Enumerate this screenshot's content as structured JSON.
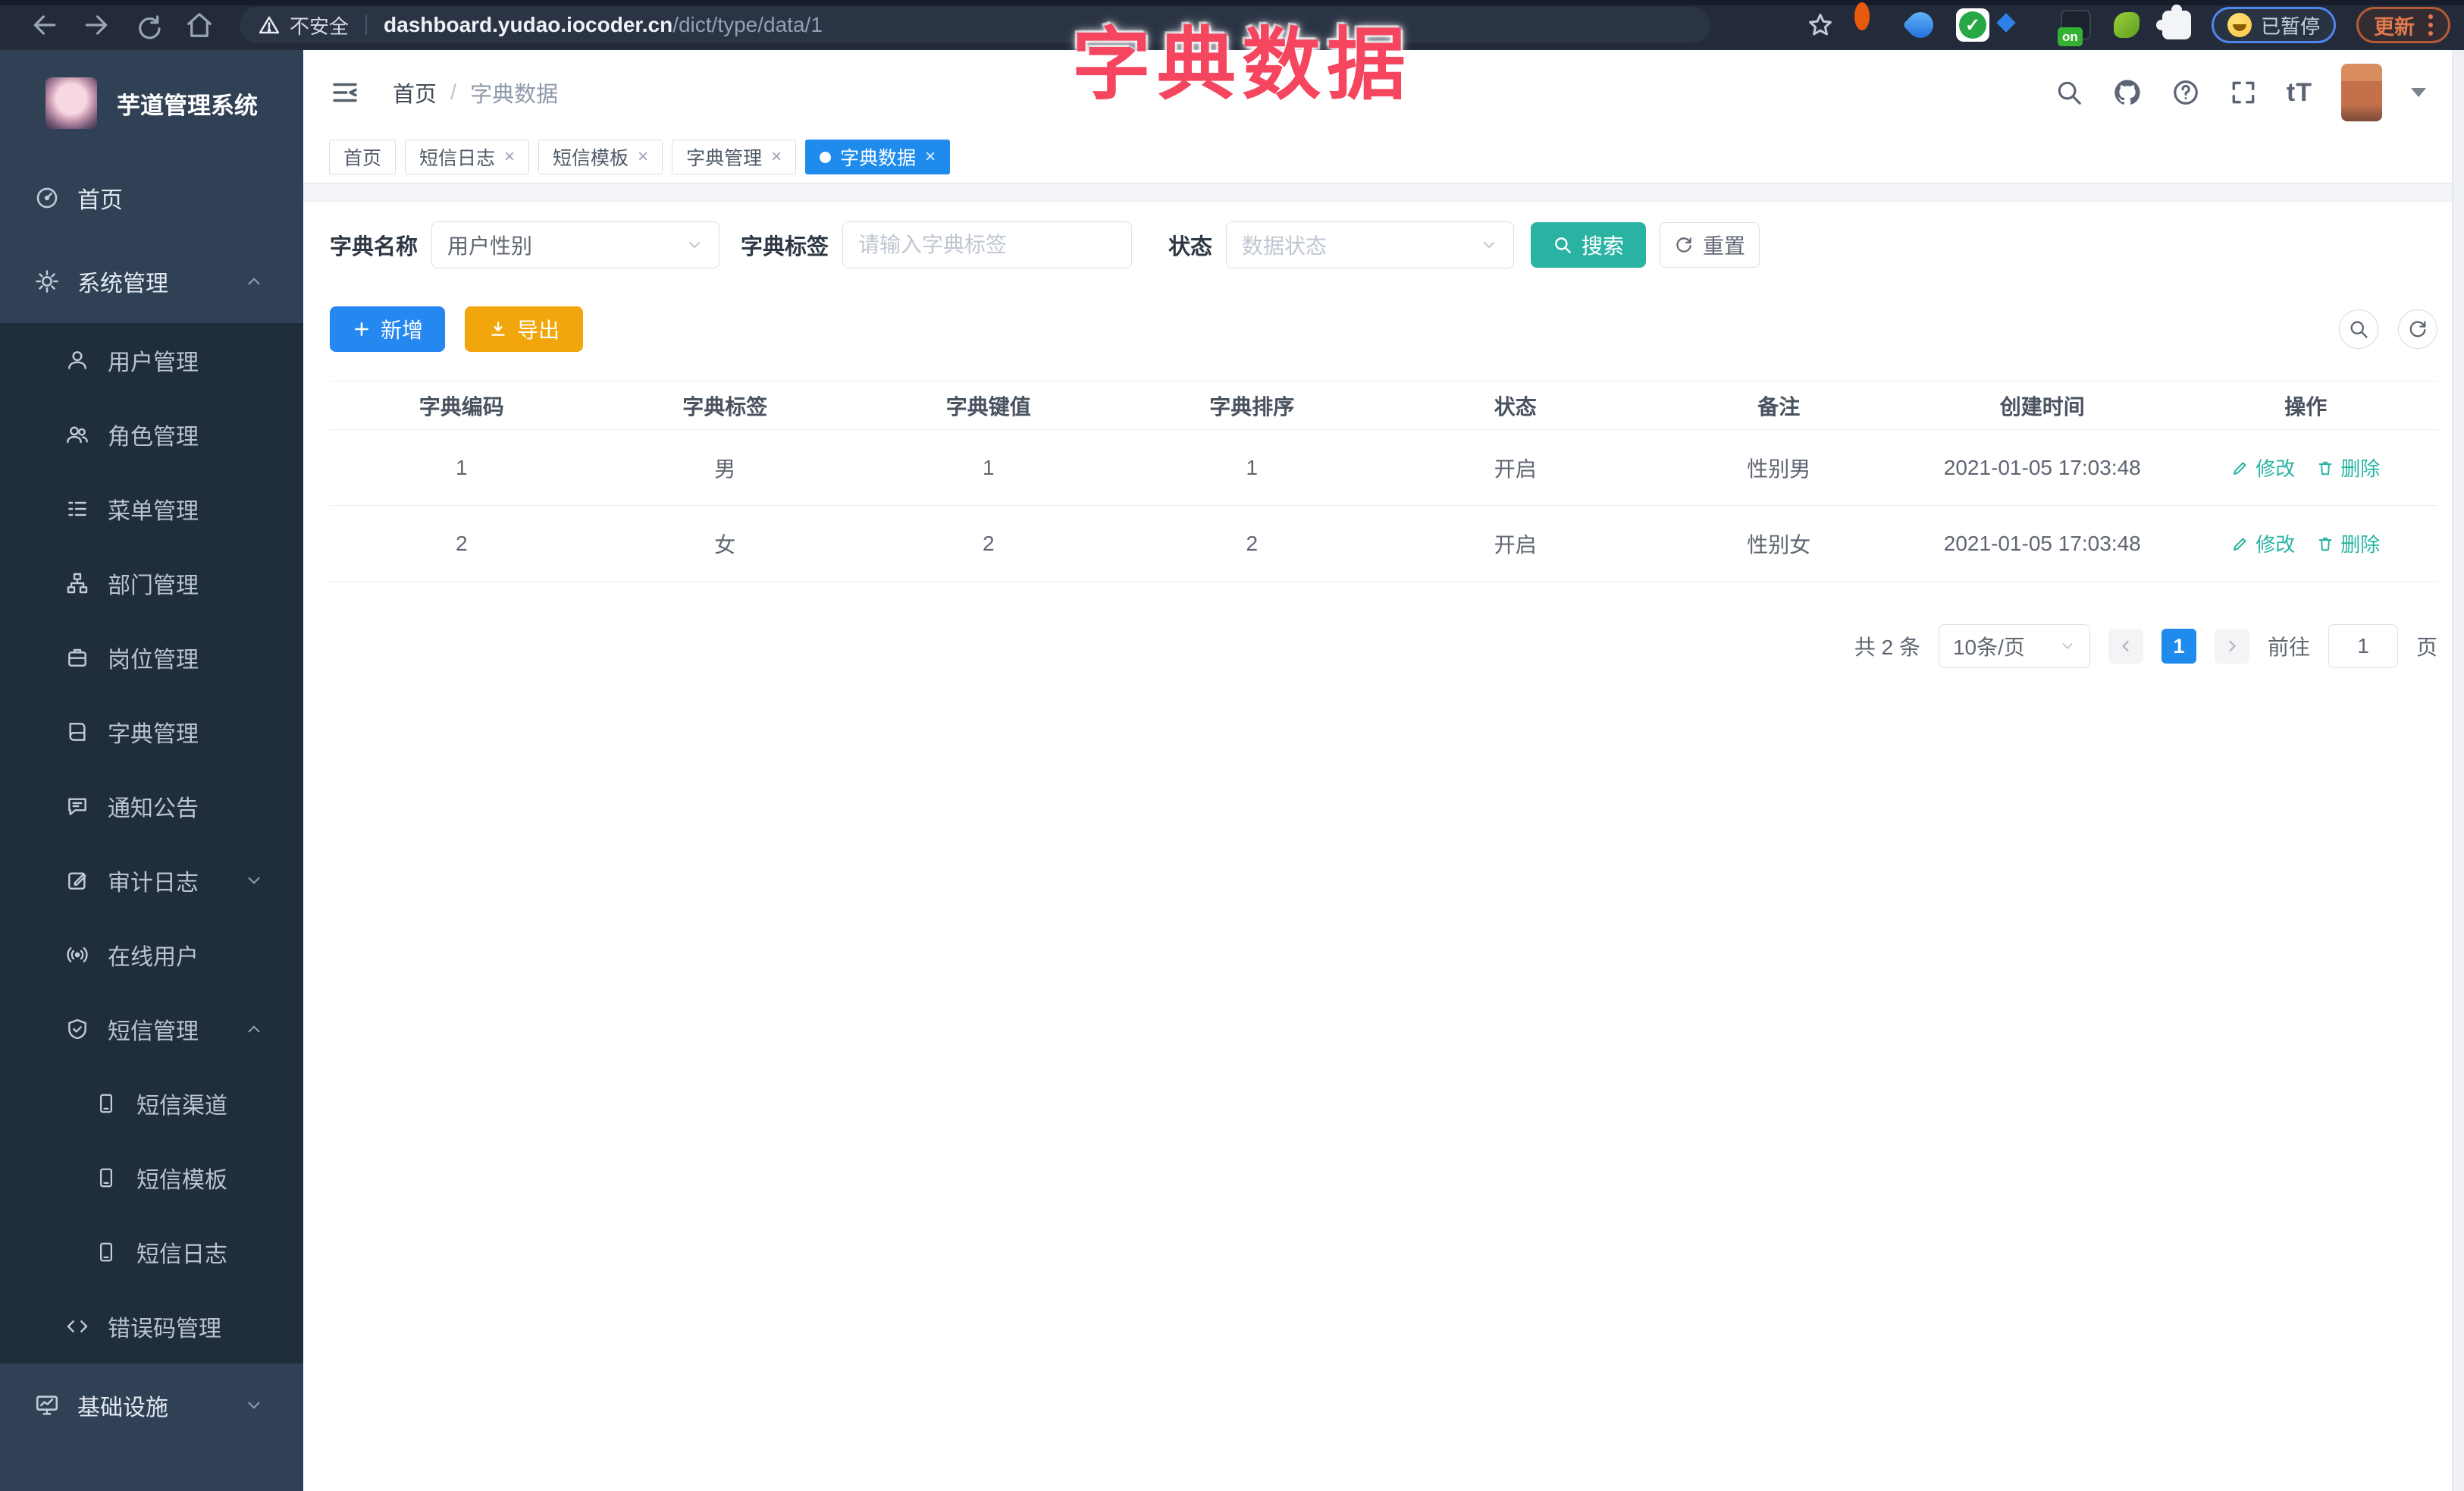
{
  "browser": {
    "security_label": "不安全",
    "url_domain": "dashboard.yudao.iocoder.cn",
    "url_path": "/dict/type/data/1",
    "ext_on_badge": "on",
    "paused_label": "已暂停",
    "update_label": "更新"
  },
  "overlay_title": "字典数据",
  "sidebar": {
    "app_title": "芋道管理系统",
    "items": [
      {
        "label": "首页"
      },
      {
        "label": "系统管理"
      },
      {
        "label": "用户管理"
      },
      {
        "label": "角色管理"
      },
      {
        "label": "菜单管理"
      },
      {
        "label": "部门管理"
      },
      {
        "label": "岗位管理"
      },
      {
        "label": "字典管理"
      },
      {
        "label": "通知公告"
      },
      {
        "label": "审计日志"
      },
      {
        "label": "在线用户"
      },
      {
        "label": "短信管理"
      },
      {
        "label": "短信渠道"
      },
      {
        "label": "短信模板"
      },
      {
        "label": "短信日志"
      },
      {
        "label": "错误码管理"
      },
      {
        "label": "基础设施"
      }
    ]
  },
  "header": {
    "breadcrumb_home": "首页",
    "breadcrumb_sep": "/",
    "breadcrumb_current": "字典数据",
    "font_size_icon": "tT"
  },
  "tabs": [
    {
      "label": "首页"
    },
    {
      "label": "短信日志"
    },
    {
      "label": "短信模板"
    },
    {
      "label": "字典管理"
    },
    {
      "label": "字典数据"
    }
  ],
  "filters": {
    "dict_type_label": "字典名称",
    "dict_type_value": "用户性别",
    "dict_label_label": "字典标签",
    "dict_label_placeholder": "请输入字典标签",
    "status_label": "状态",
    "status_placeholder": "数据状态",
    "search_label": "搜索",
    "reset_label": "重置"
  },
  "toolbar": {
    "add_label": "新增",
    "export_label": "导出"
  },
  "table": {
    "columns": [
      "字典编码",
      "字典标签",
      "字典键值",
      "字典排序",
      "状态",
      "备注",
      "创建时间",
      "操作"
    ],
    "rows": [
      {
        "code": "1",
        "label": "男",
        "value": "1",
        "sort": "1",
        "status": "开启",
        "remark": "性别男",
        "created": "2021-01-05 17:03:48"
      },
      {
        "code": "2",
        "label": "女",
        "value": "2",
        "sort": "2",
        "status": "开启",
        "remark": "性别女",
        "created": "2021-01-05 17:03:48"
      }
    ],
    "edit_label": "修改",
    "delete_label": "删除"
  },
  "pagination": {
    "total": "共 2 条",
    "page_size": "10条/页",
    "current_page": "1",
    "goto_label": "前往",
    "goto_value": "1",
    "page_unit": "页"
  },
  "colors": {
    "primary_blue": "#1f8ced",
    "teal": "#2ab3a3",
    "amber": "#f2a60d",
    "overlay_pink": "#f5455f",
    "sidebar_bg": "#304156",
    "sidebar_submenu_bg": "#1f2d3d"
  }
}
